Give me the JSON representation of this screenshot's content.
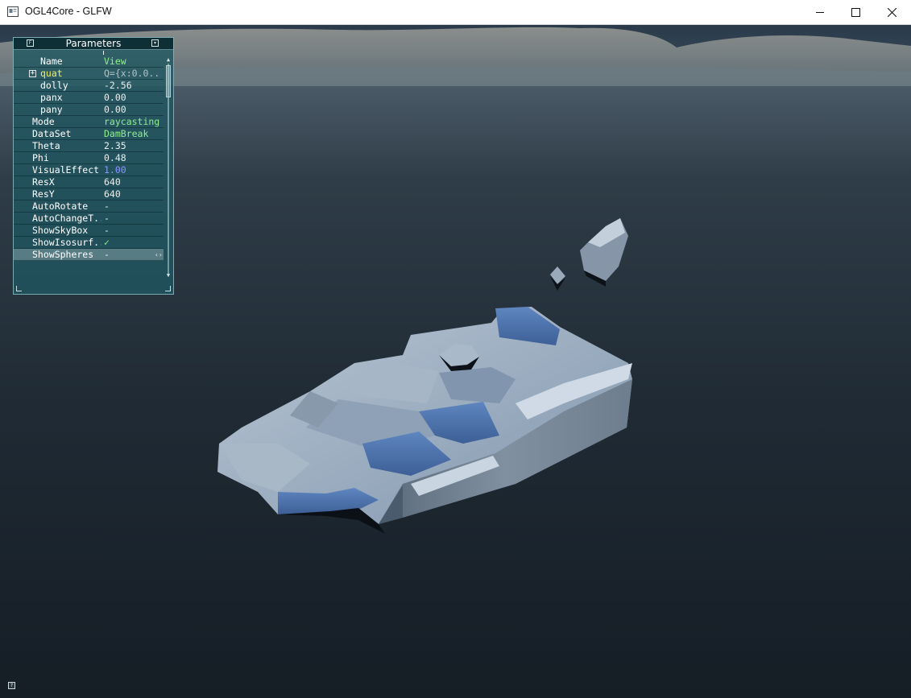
{
  "window": {
    "title": "OGL4Core - GLFW",
    "minimize_icon": "minimize-icon",
    "maximize_icon": "maximize-icon",
    "close_icon": "close-icon"
  },
  "colors": {
    "panel_bg": "#1f5660",
    "label_white": "#ffffff",
    "value_green": "#8ef08e",
    "value_yellow": "#f0f060",
    "value_gray": "#b0c4c8",
    "value_white": "#e8f0f0",
    "value_blue": "#8a98ff",
    "checkmark": "#8ef08e"
  },
  "panel": {
    "title": "Parameters",
    "fold_button": "F",
    "iconify_button": "▾",
    "rows": [
      {
        "label": "Name",
        "value": "View",
        "indent": 1,
        "value_color": "value_green"
      },
      {
        "label": "quat",
        "value": "Q={x:0.0..",
        "indent": 1,
        "expandable": true,
        "label_color": "value_yellow",
        "value_color": "value_gray"
      },
      {
        "label": "dolly",
        "value": "-2.56",
        "indent": 1,
        "value_color": "value_white"
      },
      {
        "label": "panx",
        "value": "0.00",
        "indent": 1,
        "value_color": "value_white"
      },
      {
        "label": "pany",
        "value": "0.00",
        "indent": 1,
        "value_color": "value_white"
      },
      {
        "label": "Mode",
        "value": "raycasting",
        "indent": 0,
        "value_color": "value_green"
      },
      {
        "label": "DataSet",
        "value": "DamBreak",
        "indent": 0,
        "value_color": "value_green"
      },
      {
        "label": "Theta",
        "value": "2.35",
        "indent": 0,
        "value_color": "value_white"
      },
      {
        "label": "Phi",
        "value": "0.48",
        "indent": 0,
        "value_color": "value_white"
      },
      {
        "label": "VisualEffect",
        "value": "1.00",
        "indent": 0,
        "value_color": "value_blue"
      },
      {
        "label": "ResX",
        "value": "640",
        "indent": 0,
        "value_color": "value_white"
      },
      {
        "label": "ResY",
        "value": "640",
        "indent": 0,
        "value_color": "value_white"
      },
      {
        "label": "AutoRotate",
        "value": " -",
        "indent": 0,
        "value_color": "value_white"
      },
      {
        "label": "AutoChangeT..",
        "value": " -",
        "indent": 0,
        "value_color": "value_white"
      },
      {
        "label": "ShowSkyBox",
        "value": " -",
        "indent": 0,
        "value_color": "value_white"
      },
      {
        "label": "ShowIsosurf..",
        "value": " ✓",
        "indent": 0,
        "value_color": "checkmark"
      },
      {
        "label": "ShowSpheres",
        "value": " -",
        "indent": 0,
        "value_color": "value_white",
        "selected": true
      }
    ],
    "row_arrows": "‹›"
  },
  "help_button": "?"
}
